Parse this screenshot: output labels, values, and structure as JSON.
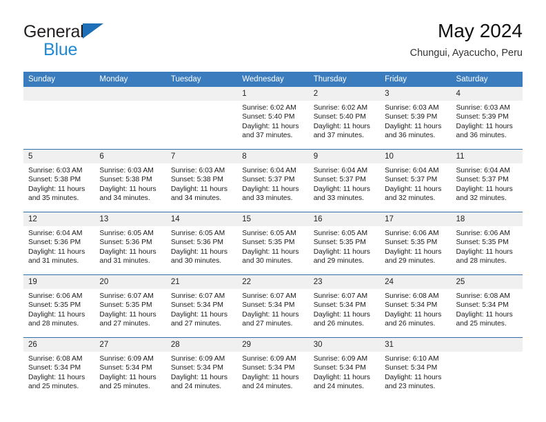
{
  "brand": {
    "word1": "General",
    "word2": "Blue",
    "triangle_color": "#1e6fb8",
    "blue_color": "#1e8ad6"
  },
  "header": {
    "month_title": "May 2024",
    "location": "Chungui, Ayacucho, Peru"
  },
  "theme": {
    "header_bg": "#3a7cbe",
    "row_divider": "#2f6ead",
    "daynum_bg": "#f0f0f0"
  },
  "columns": [
    "Sunday",
    "Monday",
    "Tuesday",
    "Wednesday",
    "Thursday",
    "Friday",
    "Saturday"
  ],
  "weeks": [
    [
      {
        "day": "",
        "empty": true
      },
      {
        "day": "",
        "empty": true
      },
      {
        "day": "",
        "empty": true
      },
      {
        "day": "1",
        "sunrise": "Sunrise: 6:02 AM",
        "sunset": "Sunset: 5:40 PM",
        "daylight": "Daylight: 11 hours and 37 minutes."
      },
      {
        "day": "2",
        "sunrise": "Sunrise: 6:02 AM",
        "sunset": "Sunset: 5:40 PM",
        "daylight": "Daylight: 11 hours and 37 minutes."
      },
      {
        "day": "3",
        "sunrise": "Sunrise: 6:03 AM",
        "sunset": "Sunset: 5:39 PM",
        "daylight": "Daylight: 11 hours and 36 minutes."
      },
      {
        "day": "4",
        "sunrise": "Sunrise: 6:03 AM",
        "sunset": "Sunset: 5:39 PM",
        "daylight": "Daylight: 11 hours and 36 minutes."
      }
    ],
    [
      {
        "day": "5",
        "sunrise": "Sunrise: 6:03 AM",
        "sunset": "Sunset: 5:38 PM",
        "daylight": "Daylight: 11 hours and 35 minutes."
      },
      {
        "day": "6",
        "sunrise": "Sunrise: 6:03 AM",
        "sunset": "Sunset: 5:38 PM",
        "daylight": "Daylight: 11 hours and 34 minutes."
      },
      {
        "day": "7",
        "sunrise": "Sunrise: 6:03 AM",
        "sunset": "Sunset: 5:38 PM",
        "daylight": "Daylight: 11 hours and 34 minutes."
      },
      {
        "day": "8",
        "sunrise": "Sunrise: 6:04 AM",
        "sunset": "Sunset: 5:37 PM",
        "daylight": "Daylight: 11 hours and 33 minutes."
      },
      {
        "day": "9",
        "sunrise": "Sunrise: 6:04 AM",
        "sunset": "Sunset: 5:37 PM",
        "daylight": "Daylight: 11 hours and 33 minutes."
      },
      {
        "day": "10",
        "sunrise": "Sunrise: 6:04 AM",
        "sunset": "Sunset: 5:37 PM",
        "daylight": "Daylight: 11 hours and 32 minutes."
      },
      {
        "day": "11",
        "sunrise": "Sunrise: 6:04 AM",
        "sunset": "Sunset: 5:37 PM",
        "daylight": "Daylight: 11 hours and 32 minutes."
      }
    ],
    [
      {
        "day": "12",
        "sunrise": "Sunrise: 6:04 AM",
        "sunset": "Sunset: 5:36 PM",
        "daylight": "Daylight: 11 hours and 31 minutes."
      },
      {
        "day": "13",
        "sunrise": "Sunrise: 6:05 AM",
        "sunset": "Sunset: 5:36 PM",
        "daylight": "Daylight: 11 hours and 31 minutes."
      },
      {
        "day": "14",
        "sunrise": "Sunrise: 6:05 AM",
        "sunset": "Sunset: 5:36 PM",
        "daylight": "Daylight: 11 hours and 30 minutes."
      },
      {
        "day": "15",
        "sunrise": "Sunrise: 6:05 AM",
        "sunset": "Sunset: 5:35 PM",
        "daylight": "Daylight: 11 hours and 30 minutes."
      },
      {
        "day": "16",
        "sunrise": "Sunrise: 6:05 AM",
        "sunset": "Sunset: 5:35 PM",
        "daylight": "Daylight: 11 hours and 29 minutes."
      },
      {
        "day": "17",
        "sunrise": "Sunrise: 6:06 AM",
        "sunset": "Sunset: 5:35 PM",
        "daylight": "Daylight: 11 hours and 29 minutes."
      },
      {
        "day": "18",
        "sunrise": "Sunrise: 6:06 AM",
        "sunset": "Sunset: 5:35 PM",
        "daylight": "Daylight: 11 hours and 28 minutes."
      }
    ],
    [
      {
        "day": "19",
        "sunrise": "Sunrise: 6:06 AM",
        "sunset": "Sunset: 5:35 PM",
        "daylight": "Daylight: 11 hours and 28 minutes."
      },
      {
        "day": "20",
        "sunrise": "Sunrise: 6:07 AM",
        "sunset": "Sunset: 5:35 PM",
        "daylight": "Daylight: 11 hours and 27 minutes."
      },
      {
        "day": "21",
        "sunrise": "Sunrise: 6:07 AM",
        "sunset": "Sunset: 5:34 PM",
        "daylight": "Daylight: 11 hours and 27 minutes."
      },
      {
        "day": "22",
        "sunrise": "Sunrise: 6:07 AM",
        "sunset": "Sunset: 5:34 PM",
        "daylight": "Daylight: 11 hours and 27 minutes."
      },
      {
        "day": "23",
        "sunrise": "Sunrise: 6:07 AM",
        "sunset": "Sunset: 5:34 PM",
        "daylight": "Daylight: 11 hours and 26 minutes."
      },
      {
        "day": "24",
        "sunrise": "Sunrise: 6:08 AM",
        "sunset": "Sunset: 5:34 PM",
        "daylight": "Daylight: 11 hours and 26 minutes."
      },
      {
        "day": "25",
        "sunrise": "Sunrise: 6:08 AM",
        "sunset": "Sunset: 5:34 PM",
        "daylight": "Daylight: 11 hours and 25 minutes."
      }
    ],
    [
      {
        "day": "26",
        "sunrise": "Sunrise: 6:08 AM",
        "sunset": "Sunset: 5:34 PM",
        "daylight": "Daylight: 11 hours and 25 minutes."
      },
      {
        "day": "27",
        "sunrise": "Sunrise: 6:09 AM",
        "sunset": "Sunset: 5:34 PM",
        "daylight": "Daylight: 11 hours and 25 minutes."
      },
      {
        "day": "28",
        "sunrise": "Sunrise: 6:09 AM",
        "sunset": "Sunset: 5:34 PM",
        "daylight": "Daylight: 11 hours and 24 minutes."
      },
      {
        "day": "29",
        "sunrise": "Sunrise: 6:09 AM",
        "sunset": "Sunset: 5:34 PM",
        "daylight": "Daylight: 11 hours and 24 minutes."
      },
      {
        "day": "30",
        "sunrise": "Sunrise: 6:09 AM",
        "sunset": "Sunset: 5:34 PM",
        "daylight": "Daylight: 11 hours and 24 minutes."
      },
      {
        "day": "31",
        "sunrise": "Sunrise: 6:10 AM",
        "sunset": "Sunset: 5:34 PM",
        "daylight": "Daylight: 11 hours and 23 minutes."
      },
      {
        "day": "",
        "empty": true
      }
    ]
  ]
}
